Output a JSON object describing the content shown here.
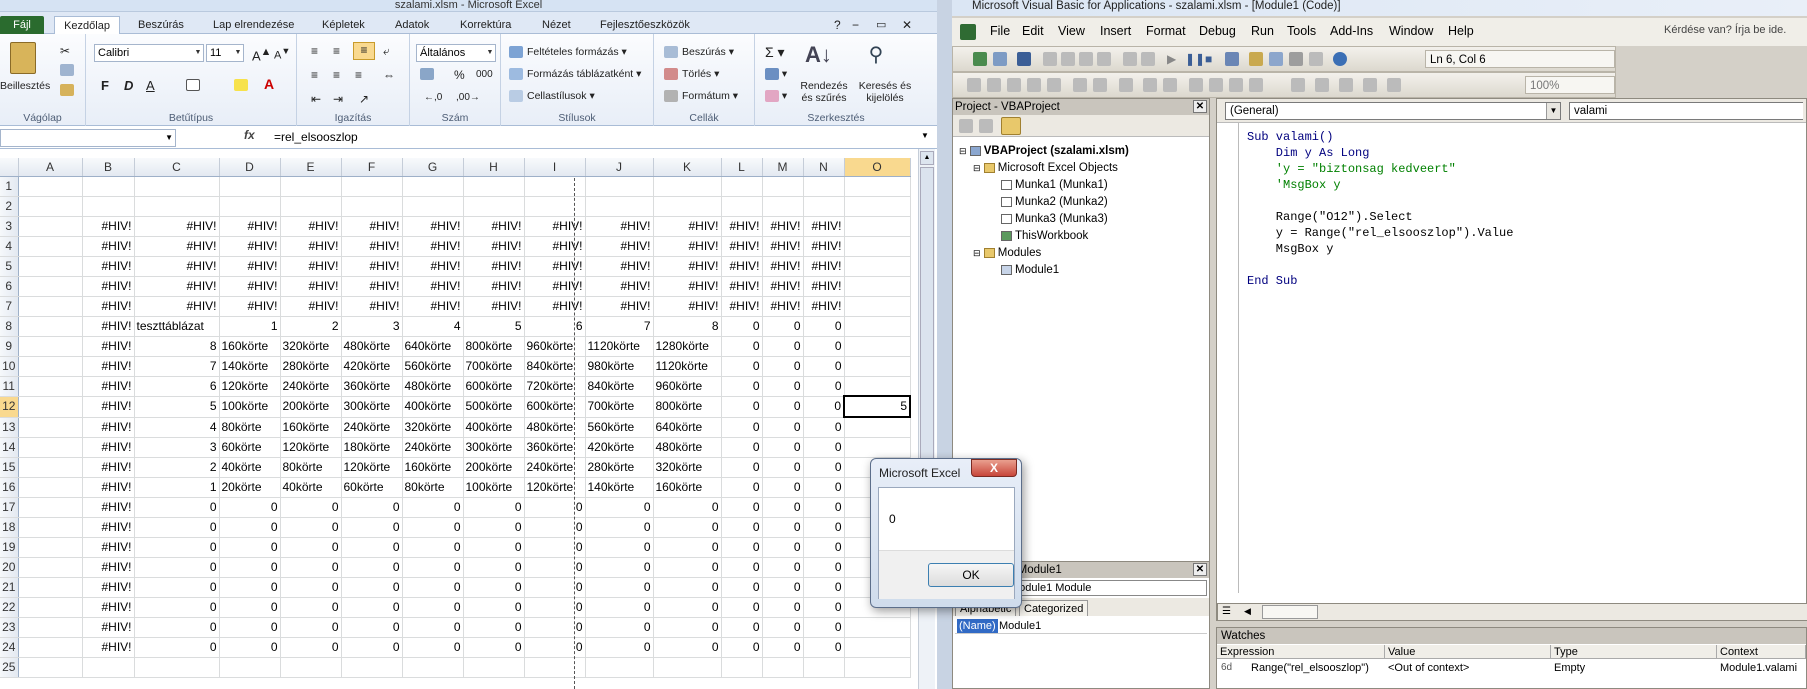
{
  "excel": {
    "title": "szalami.xlsm - Microsoft Excel",
    "tabs": [
      "Fájl",
      "Kezdőlap",
      "Beszúrás",
      "Lap elrendezése",
      "Képletek",
      "Adatok",
      "Korrektúra",
      "Nézet",
      "Fejlesztőeszközök"
    ],
    "ribbon": {
      "paste": "Beillesztés",
      "font_name": "Calibri",
      "font_size": "11",
      "bold": "F",
      "italic": "D",
      "underline": "A",
      "number_format": "Általános",
      "cond_format": "Feltételes formázás",
      "format_table": "Formázás táblázatként",
      "cell_styles": "Cellastílusok",
      "insert": "Beszúrás",
      "delete": "Törlés",
      "format": "Formátum",
      "sort": "Rendezés és szűrés",
      "find": "Keresés és kijelölés",
      "groups": [
        "Vágólap",
        "Betűtípus",
        "Igazítás",
        "Szám",
        "Stílusok",
        "Cellák",
        "Szerkesztés"
      ]
    },
    "formula": "=rel_elsooszlop",
    "fx": "fx",
    "columns": [
      "A",
      "B",
      "C",
      "D",
      "E",
      "F",
      "G",
      "H",
      "I",
      "J",
      "K",
      "L",
      "M",
      "N",
      "O"
    ],
    "selected_col": "O",
    "selected_row": "12",
    "rows": [
      {
        "n": "1",
        "c": [
          "",
          "",
          "",
          "",
          "",
          "",
          "",
          "",
          "",
          "",
          "",
          "",
          "",
          "",
          ""
        ]
      },
      {
        "n": "2",
        "c": [
          "",
          "",
          "",
          "",
          "",
          "",
          "",
          "",
          "",
          "",
          "",
          "",
          "",
          "",
          ""
        ]
      },
      {
        "n": "3",
        "c": [
          "",
          "#HIV!",
          "#HIV!",
          "#HIV!",
          "#HIV!",
          "#HIV!",
          "#HIV!",
          "#HIV!",
          "#HIV!",
          "#HIV!",
          "#HIV!",
          "#HIV!",
          "#HIV!",
          "#HIV!",
          ""
        ]
      },
      {
        "n": "4",
        "c": [
          "",
          "#HIV!",
          "#HIV!",
          "#HIV!",
          "#HIV!",
          "#HIV!",
          "#HIV!",
          "#HIV!",
          "#HIV!",
          "#HIV!",
          "#HIV!",
          "#HIV!",
          "#HIV!",
          "#HIV!",
          ""
        ]
      },
      {
        "n": "5",
        "c": [
          "",
          "#HIV!",
          "#HIV!",
          "#HIV!",
          "#HIV!",
          "#HIV!",
          "#HIV!",
          "#HIV!",
          "#HIV!",
          "#HIV!",
          "#HIV!",
          "#HIV!",
          "#HIV!",
          "#HIV!",
          ""
        ]
      },
      {
        "n": "6",
        "c": [
          "",
          "#HIV!",
          "#HIV!",
          "#HIV!",
          "#HIV!",
          "#HIV!",
          "#HIV!",
          "#HIV!",
          "#HIV!",
          "#HIV!",
          "#HIV!",
          "#HIV!",
          "#HIV!",
          "#HIV!",
          ""
        ]
      },
      {
        "n": "7",
        "c": [
          "",
          "#HIV!",
          "#HIV!",
          "#HIV!",
          "#HIV!",
          "#HIV!",
          "#HIV!",
          "#HIV!",
          "#HIV!",
          "#HIV!",
          "#HIV!",
          "#HIV!",
          "#HIV!",
          "#HIV!",
          ""
        ]
      },
      {
        "n": "8",
        "c": [
          "",
          "#HIV!",
          "teszttáblázat",
          "1",
          "2",
          "3",
          "4",
          "5",
          "6",
          "7",
          "8",
          "0",
          "0",
          "0",
          ""
        ]
      },
      {
        "n": "9",
        "c": [
          "",
          "#HIV!",
          "8",
          "160körte",
          "320körte",
          "480körte",
          "640körte",
          "800körte",
          "960körte",
          "1120körte",
          "1280körte",
          "0",
          "0",
          "0",
          ""
        ]
      },
      {
        "n": "10",
        "c": [
          "",
          "#HIV!",
          "7",
          "140körte",
          "280körte",
          "420körte",
          "560körte",
          "700körte",
          "840körte",
          "980körte",
          "1120körte",
          "0",
          "0",
          "0",
          ""
        ]
      },
      {
        "n": "11",
        "c": [
          "",
          "#HIV!",
          "6",
          "120körte",
          "240körte",
          "360körte",
          "480körte",
          "600körte",
          "720körte",
          "840körte",
          "960körte",
          "0",
          "0",
          "0",
          ""
        ]
      },
      {
        "n": "12",
        "c": [
          "",
          "#HIV!",
          "5",
          "100körte",
          "200körte",
          "300körte",
          "400körte",
          "500körte",
          "600körte",
          "700körte",
          "800körte",
          "0",
          "0",
          "0",
          "5"
        ]
      },
      {
        "n": "13",
        "c": [
          "",
          "#HIV!",
          "4",
          "80körte",
          "160körte",
          "240körte",
          "320körte",
          "400körte",
          "480körte",
          "560körte",
          "640körte",
          "0",
          "0",
          "0",
          ""
        ]
      },
      {
        "n": "14",
        "c": [
          "",
          "#HIV!",
          "3",
          "60körte",
          "120körte",
          "180körte",
          "240körte",
          "300körte",
          "360körte",
          "420körte",
          "480körte",
          "0",
          "0",
          "0",
          ""
        ]
      },
      {
        "n": "15",
        "c": [
          "",
          "#HIV!",
          "2",
          "40körte",
          "80körte",
          "120körte",
          "160körte",
          "200körte",
          "240körte",
          "280körte",
          "320körte",
          "0",
          "0",
          "0",
          ""
        ]
      },
      {
        "n": "16",
        "c": [
          "",
          "#HIV!",
          "1",
          "20körte",
          "40körte",
          "60körte",
          "80körte",
          "100körte",
          "120körte",
          "140körte",
          "160körte",
          "0",
          "0",
          "0",
          ""
        ]
      },
      {
        "n": "17",
        "c": [
          "",
          "#HIV!",
          "0",
          "0",
          "0",
          "0",
          "0",
          "0",
          "0",
          "0",
          "0",
          "0",
          "0",
          "0",
          ""
        ]
      },
      {
        "n": "18",
        "c": [
          "",
          "#HIV!",
          "0",
          "0",
          "0",
          "0",
          "0",
          "0",
          "0",
          "0",
          "0",
          "0",
          "0",
          "0",
          ""
        ]
      },
      {
        "n": "19",
        "c": [
          "",
          "#HIV!",
          "0",
          "0",
          "0",
          "0",
          "0",
          "0",
          "0",
          "0",
          "0",
          "0",
          "0",
          "0",
          ""
        ]
      },
      {
        "n": "20",
        "c": [
          "",
          "#HIV!",
          "0",
          "0",
          "0",
          "0",
          "0",
          "0",
          "0",
          "0",
          "0",
          "0",
          "0",
          "0",
          ""
        ]
      },
      {
        "n": "21",
        "c": [
          "",
          "#HIV!",
          "0",
          "0",
          "0",
          "0",
          "0",
          "0",
          "0",
          "0",
          "0",
          "0",
          "0",
          "0",
          ""
        ]
      },
      {
        "n": "22",
        "c": [
          "",
          "#HIV!",
          "0",
          "0",
          "0",
          "0",
          "0",
          "0",
          "0",
          "0",
          "0",
          "0",
          "0",
          "0",
          ""
        ]
      },
      {
        "n": "23",
        "c": [
          "",
          "#HIV!",
          "0",
          "0",
          "0",
          "0",
          "0",
          "0",
          "0",
          "0",
          "0",
          "0",
          "0",
          "0",
          ""
        ]
      },
      {
        "n": "24",
        "c": [
          "",
          "#HIV!",
          "0",
          "0",
          "0",
          "0",
          "0",
          "0",
          "0",
          "0",
          "0",
          "0",
          "0",
          "0",
          ""
        ]
      },
      {
        "n": "25",
        "c": [
          "",
          "",
          "",
          "",
          "",
          "",
          "",
          "",
          "",
          "",
          "",
          "",
          "",
          "",
          ""
        ]
      }
    ]
  },
  "vba": {
    "title": "Microsoft Visual Basic for Applications - szalami.xlsm - [Module1 (Code)]",
    "menu": [
      "File",
      "Edit",
      "View",
      "Insert",
      "Format",
      "Debug",
      "Run",
      "Tools",
      "Add-Ins",
      "Window",
      "Help"
    ],
    "ask": "Kérdése van? Írja be ide.",
    "lncol": "Ln 6, Col 6",
    "zoom": "100%",
    "project_title": "Project - VBAProject",
    "tree": {
      "root": "VBAProject (szalami.xlsm)",
      "objects": "Microsoft Excel Objects",
      "sheet1": "Munka1 (Munka1)",
      "sheet2": "Munka2 (Munka2)",
      "sheet3": "Munka3 (Munka3)",
      "workbook": "ThisWorkbook",
      "modules": "Modules",
      "module1": "Module1"
    },
    "props": {
      "title": "Properties - Module1",
      "combo": "Module1 Module",
      "tab_alpha": "Alphabetic",
      "tab_cat": "Categorized",
      "name_key": "(Name)",
      "name_val": "Module1"
    },
    "code_general": "(General)",
    "code_proc": "valami",
    "code_lines": [
      {
        "t": "Sub valami()",
        "cls": "c"
      },
      {
        "t": "    Dim y As Long",
        "cls": "c"
      },
      {
        "t": "    'y = \"biztonsag kedveert\"",
        "cls": "g"
      },
      {
        "t": "    'MsgBox y",
        "cls": "g"
      },
      {
        "t": "",
        "cls": "c"
      },
      {
        "t": "    Range(\"O12\").Select",
        "cls": "n"
      },
      {
        "t": "    y = Range(\"rel_elsooszlop\").Value",
        "cls": "n"
      },
      {
        "t": "    MsgBox y",
        "cls": "n"
      },
      {
        "t": "",
        "cls": "c"
      },
      {
        "t": "End Sub",
        "cls": "c"
      }
    ],
    "watches": {
      "title": "Watches",
      "headers": [
        "Expression",
        "Value",
        "Type",
        "Context"
      ],
      "row": {
        "expr": "Range(\"rel_elsooszlop\")",
        "value": "<Out of context>",
        "type": "Empty",
        "context": "Module1.valami"
      }
    }
  },
  "msgbox": {
    "title": "Microsoft Excel",
    "text": "0",
    "ok": "OK",
    "close": "X"
  }
}
